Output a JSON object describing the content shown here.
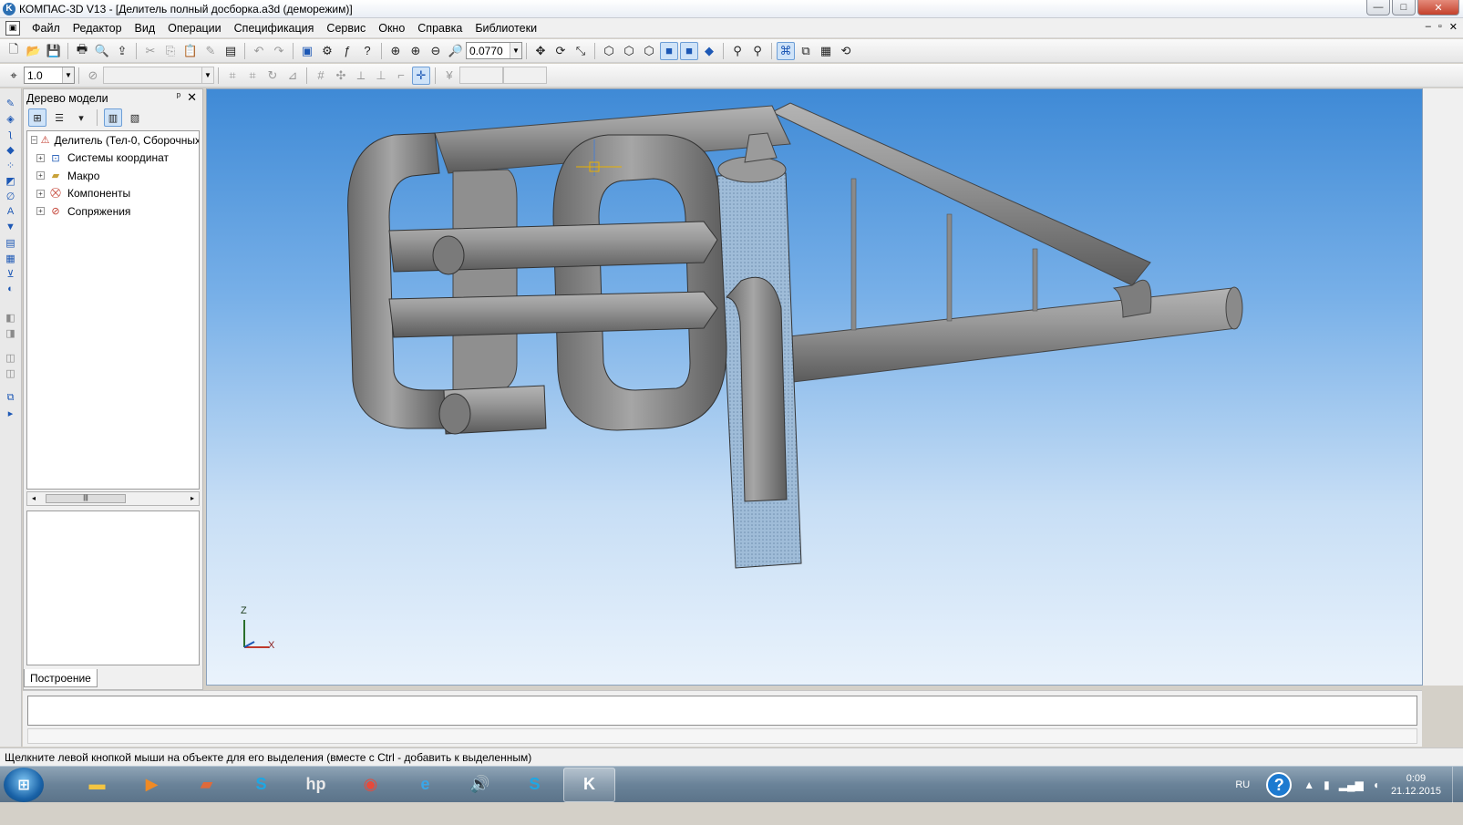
{
  "window": {
    "title": "КОМПАС-3D V13 - [Делитель полный досборка.a3d (деморежим)]",
    "controls": {
      "minimize": "—",
      "maximize": "□",
      "close": "✕"
    }
  },
  "menu": {
    "items": [
      "Файл",
      "Редактор",
      "Вид",
      "Операции",
      "Спецификация",
      "Сервис",
      "Окно",
      "Справка",
      "Библиотеки"
    ],
    "mdi_controls": [
      "–",
      "▫",
      "✕"
    ]
  },
  "toolbar1": {
    "zoom_value": "0.0770"
  },
  "toolbar2": {
    "step_value": "1.0",
    "style_value": "",
    "coord1": "",
    "coord2": ""
  },
  "model_tree": {
    "title": "Дерево модели",
    "pin": "ᵖ",
    "close": "✕",
    "root": "Делитель (Тел-0, Сборочных",
    "items": [
      "Системы координат",
      "Макро",
      "Компоненты",
      "Сопряжения"
    ],
    "tab_label": "Построение"
  },
  "viewport": {
    "axis_z": "Z",
    "axis_x": "X"
  },
  "statusbar": {
    "text": "Щелкните левой кнопкой мыши на объекте для его выделения (вместе с Ctrl - добавить к выделенным)"
  },
  "taskbar": {
    "language": "RU",
    "time": "0:09",
    "date": "21.12.2015"
  },
  "colors": {
    "viewport_top": "#3f8ad6",
    "viewport_bottom": "#eaf3fc",
    "pipe": "#8e8e8e",
    "pipe_dark": "#5a5a5a",
    "accent": "#1d58b5"
  }
}
